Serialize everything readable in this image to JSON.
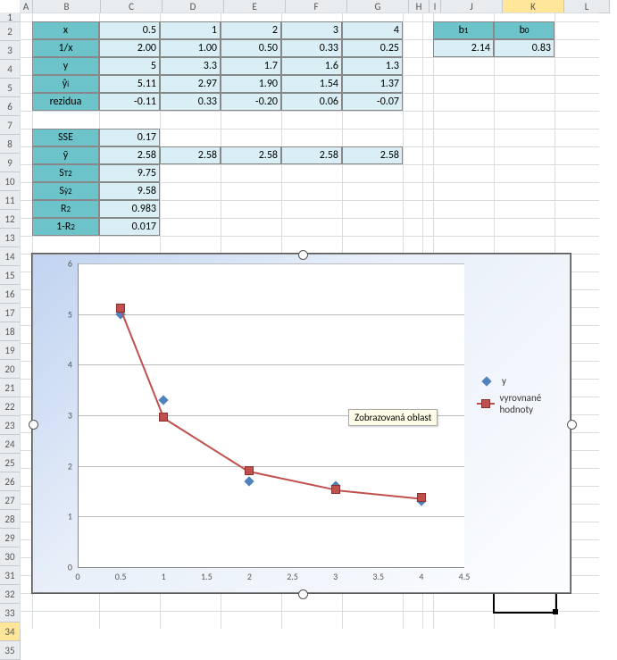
{
  "cols": [
    "A",
    "B",
    "C",
    "D",
    "E",
    "F",
    "G",
    "H",
    "I",
    "J",
    "K",
    "L"
  ],
  "col_w": {
    "A": 14,
    "B": 75,
    "C": 68,
    "D": 68,
    "E": 68,
    "F": 68,
    "G": 68,
    "H": 22,
    "I": 12,
    "J": 68,
    "K": 68,
    "L": 50
  },
  "rows": [
    1,
    2,
    3,
    4,
    5,
    6,
    7,
    8,
    9,
    10,
    11,
    12,
    13,
    14,
    15,
    16,
    17,
    18,
    19,
    20,
    21,
    22,
    23,
    24,
    25,
    26,
    27,
    28,
    29,
    30,
    31,
    32,
    33,
    34,
    35
  ],
  "row_h": {
    "1": 10,
    "default": 20
  },
  "table1": {
    "headers_row": [
      "x",
      "1/x",
      "y",
      "ŷᵢ",
      "rezidua"
    ],
    "row_x": [
      "0.5",
      "1",
      "2",
      "3",
      "4"
    ],
    "row_1x": [
      "2.00",
      "1.00",
      "0.50",
      "0.33",
      "0.25"
    ],
    "row_y": [
      "5",
      "3.3",
      "1.7",
      "1.6",
      "1.3"
    ],
    "row_yhat": [
      "5.11",
      "2.97",
      "1.90",
      "1.54",
      "1.37"
    ],
    "row_res": [
      "-0.11",
      "0.33",
      "-0.20",
      "0.06",
      "-0.07"
    ]
  },
  "stats": {
    "labels": [
      "SSE",
      "ȳ",
      "S²_T",
      "S²_ŷ",
      "R²",
      "1-R²"
    ],
    "values": [
      "0.17",
      "2.58",
      "9.75",
      "9.58",
      "0.983",
      "0.017"
    ],
    "extra_ybar": [
      "2.58",
      "2.58",
      "2.58",
      "2.58"
    ]
  },
  "coefs": {
    "labels": [
      "b₁",
      "b₀"
    ],
    "values": [
      "2.14",
      "0.83"
    ]
  },
  "chart_data": {
    "type": "scatter+line",
    "xlim": [
      0,
      4.5
    ],
    "ylim": [
      0,
      6
    ],
    "xticks": [
      0,
      0.5,
      1,
      1.5,
      2,
      2.5,
      3,
      3.5,
      4,
      4.5
    ],
    "yticks": [
      0,
      1,
      2,
      3,
      4,
      5,
      6
    ],
    "series": [
      {
        "name": "y",
        "type": "scatter",
        "marker": "diamond",
        "color": "#4f81bd",
        "x": [
          0.5,
          1,
          2,
          3,
          4
        ],
        "y": [
          5,
          3.3,
          1.7,
          1.6,
          1.3
        ]
      },
      {
        "name": "vyrovnané hodnoty",
        "type": "line",
        "marker": "square",
        "color": "#c0504d",
        "x": [
          0.5,
          1,
          2,
          3,
          4
        ],
        "y": [
          5.11,
          2.97,
          1.9,
          1.54,
          1.37
        ]
      }
    ],
    "tooltip": "Zobrazovaná oblast"
  },
  "selected_cell": "K34"
}
